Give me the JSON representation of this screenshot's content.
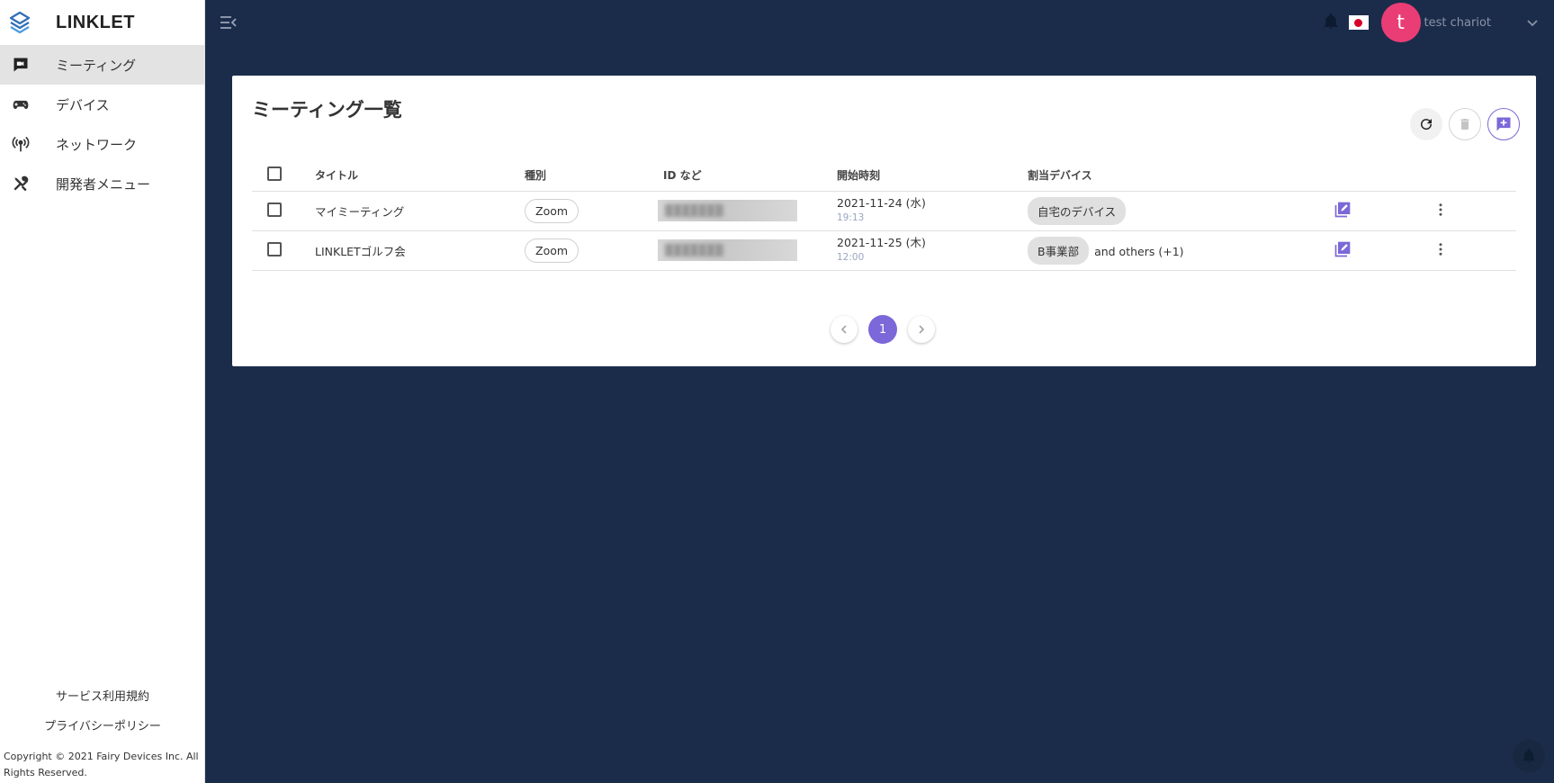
{
  "app": {
    "name": "LINKLET"
  },
  "sidebar": {
    "items": [
      {
        "label": "ミーティング",
        "icon": "video-camera-icon",
        "active": true
      },
      {
        "label": "デバイス",
        "icon": "gamepad-icon",
        "active": false
      },
      {
        "label": "ネットワーク",
        "icon": "broadcast-tower-icon",
        "active": false
      },
      {
        "label": "開発者メニュー",
        "icon": "tools-icon",
        "active": false
      }
    ],
    "footer_links": [
      "サービス利用規約",
      "プライバシーポリシー"
    ],
    "copyright": "Copyright © 2021 Fairy Devices Inc. All Rights Reserved."
  },
  "topbar": {
    "notification_icon": "bell-icon",
    "language_flag": "japan-flag-icon",
    "avatar_letter": "t",
    "user_name": "test chariot",
    "avatar_color": "#ea3d76"
  },
  "page": {
    "title": "ミーティング一覧",
    "actions": [
      "refresh-icon",
      "delete-icon",
      "add-meeting-icon"
    ]
  },
  "table": {
    "columns": [
      "タイトル",
      "種別",
      "ID など",
      "開始時刻",
      "割当デバイス"
    ],
    "rows": [
      {
        "title": "マイミーティング",
        "type": "Zoom",
        "id": "",
        "date": "2021-11-24 (水)",
        "time": "19:13",
        "device": "自宅のデバイス",
        "others": ""
      },
      {
        "title": "LINKLETゴルフ会",
        "type": "Zoom",
        "id": "",
        "date": "2021-11-25 (木)",
        "time": "12:00",
        "device": "B事業部",
        "others": "and others (+1)"
      }
    ]
  },
  "pagination": {
    "current": "1"
  },
  "colors": {
    "background": "#1b2c4b",
    "accent": "#7c68d8"
  }
}
